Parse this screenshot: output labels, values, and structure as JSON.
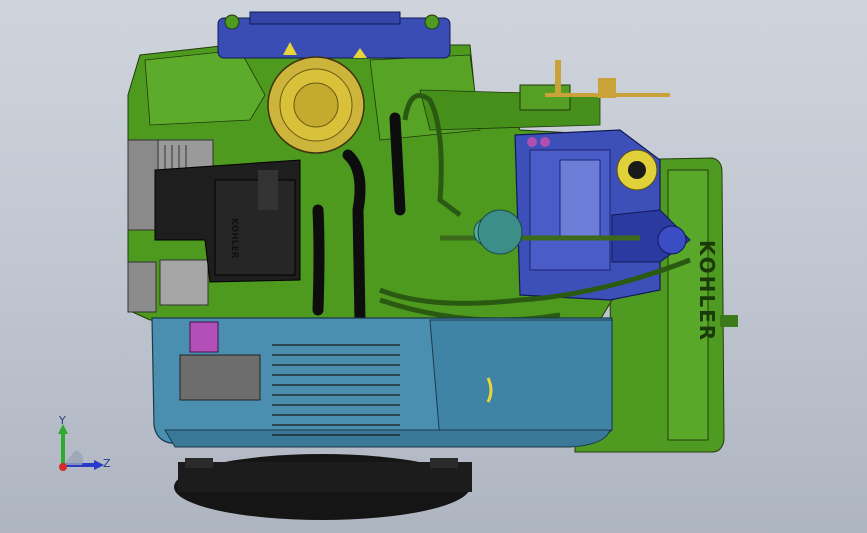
{
  "viewport": {
    "background": "#c3c9d2",
    "part_colors": {
      "engine_block": "#4e9a1f",
      "cooling_shroud": "#4a8fb0",
      "ignition_module": "#3d4fb8",
      "air_cleaner_base": "#1a1a1a",
      "oil_filler_cap": "#d9c23a"
    }
  },
  "model": {
    "brand_text": "KOHLER",
    "small_label": "KOHLER"
  },
  "triad": {
    "y_label": "Y",
    "z_label": "Z",
    "y_color": "#2faa2f",
    "z_color": "#2a3ac8",
    "x_color": "#d22a2a"
  }
}
